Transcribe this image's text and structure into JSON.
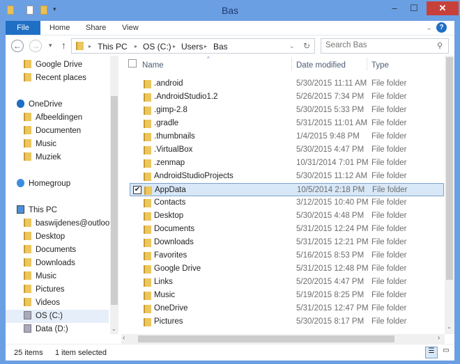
{
  "window": {
    "title": "Bas",
    "minimize": "–",
    "maximize": "☐",
    "close": "✕"
  },
  "ribbon": {
    "tabs": [
      "File",
      "Home",
      "Share",
      "View"
    ],
    "help": "?",
    "expand": "⌄"
  },
  "address": {
    "path": [
      "This PC",
      "OS (C:)",
      "Users",
      "Bas"
    ],
    "search_placeholder": "Search Bas"
  },
  "sidebar": {
    "items": [
      {
        "label": "Google Drive",
        "icon": "folder-icon",
        "indent": 1
      },
      {
        "label": "Recent places",
        "icon": "recent-icon",
        "indent": 1
      },
      {
        "label": "",
        "gap": true
      },
      {
        "label": "OneDrive",
        "icon": "onedrive-icon",
        "indent": 0
      },
      {
        "label": "Afbeeldingen",
        "icon": "folder-icon",
        "indent": 1
      },
      {
        "label": "Documenten",
        "icon": "folder-icon",
        "indent": 1
      },
      {
        "label": "Music",
        "icon": "folder-icon",
        "indent": 1
      },
      {
        "label": "Muziek",
        "icon": "folder-icon",
        "indent": 1
      },
      {
        "label": "",
        "gap": true
      },
      {
        "label": "Homegroup",
        "icon": "homegroup-icon",
        "indent": 0
      },
      {
        "label": "",
        "gap": true
      },
      {
        "label": "This PC",
        "icon": "computer-icon",
        "indent": 0
      },
      {
        "label": "baswijdenes@outlook",
        "icon": "user-icon",
        "indent": 1
      },
      {
        "label": "Desktop",
        "icon": "folder-icon",
        "indent": 1
      },
      {
        "label": "Documents",
        "icon": "folder-icon",
        "indent": 1
      },
      {
        "label": "Downloads",
        "icon": "folder-icon",
        "indent": 1
      },
      {
        "label": "Music",
        "icon": "folder-icon",
        "indent": 1
      },
      {
        "label": "Pictures",
        "icon": "folder-icon",
        "indent": 1
      },
      {
        "label": "Videos",
        "icon": "folder-icon",
        "indent": 1
      },
      {
        "label": "OS (C:)",
        "icon": "drive-icon",
        "indent": 1,
        "selected": true
      },
      {
        "label": "Data (D:)",
        "icon": "drive-icon",
        "indent": 1
      }
    ]
  },
  "columns": {
    "name": "Name",
    "date": "Date modified",
    "type": "Type"
  },
  "files": [
    {
      "name": ".android",
      "date": "5/30/2015 11:11 AM",
      "type": "File folder"
    },
    {
      "name": ".AndroidStudio1.2",
      "date": "5/26/2015 7:34 PM",
      "type": "File folder"
    },
    {
      "name": ".gimp-2.8",
      "date": "5/30/2015 5:33 PM",
      "type": "File folder"
    },
    {
      "name": ".gradle",
      "date": "5/31/2015 11:01 AM",
      "type": "File folder"
    },
    {
      "name": ".thumbnails",
      "date": "1/4/2015 9:48 PM",
      "type": "File folder"
    },
    {
      "name": ".VirtualBox",
      "date": "5/30/2015 4:47 PM",
      "type": "File folder"
    },
    {
      "name": ".zenmap",
      "date": "10/31/2014 7:01 PM",
      "type": "File folder"
    },
    {
      "name": "AndroidStudioProjects",
      "date": "5/30/2015 11:12 AM",
      "type": "File folder"
    },
    {
      "name": "AppData",
      "date": "10/5/2014 2:18 PM",
      "type": "File folder",
      "selected": true
    },
    {
      "name": "Contacts",
      "date": "3/12/2015 10:40 PM",
      "type": "File folder"
    },
    {
      "name": "Desktop",
      "date": "5/30/2015 4:48 PM",
      "type": "File folder"
    },
    {
      "name": "Documents",
      "date": "5/31/2015 12:24 PM",
      "type": "File folder"
    },
    {
      "name": "Downloads",
      "date": "5/31/2015 12:21 PM",
      "type": "File folder"
    },
    {
      "name": "Favorites",
      "date": "5/16/2015 8:53 PM",
      "type": "File folder"
    },
    {
      "name": "Google Drive",
      "date": "5/31/2015 12:48 PM",
      "type": "File folder"
    },
    {
      "name": "Links",
      "date": "5/20/2015 4:47 PM",
      "type": "File folder"
    },
    {
      "name": "Music",
      "date": "5/19/2015 8:25 PM",
      "type": "File folder"
    },
    {
      "name": "OneDrive",
      "date": "5/31/2015 12:47 PM",
      "type": "File folder"
    },
    {
      "name": "Pictures",
      "date": "5/30/2015 8:17 PM",
      "type": "File folder"
    }
  ],
  "status": {
    "count": "25 items",
    "selected": "1 item selected"
  },
  "colors": {
    "accent": "#1f6fc5",
    "frame": "#6b9fe3",
    "close": "#c7413a",
    "selection": "#d8e8f8"
  }
}
